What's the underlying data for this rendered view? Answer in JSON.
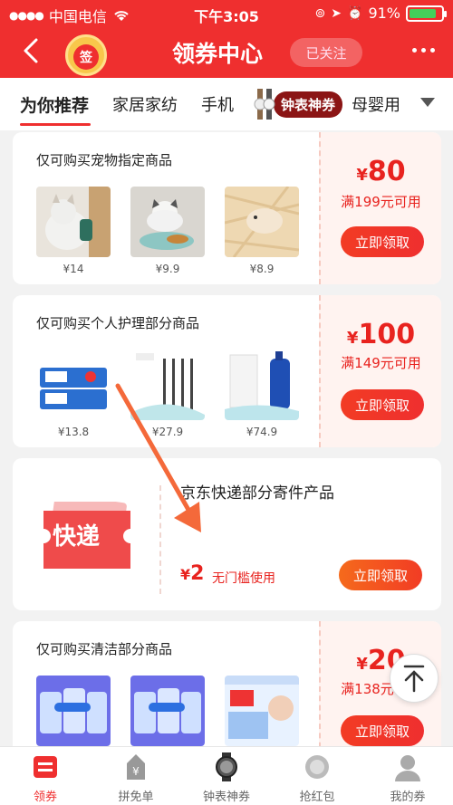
{
  "status": {
    "carrier": "中国电信",
    "time": "下午3:05",
    "battery": "91%"
  },
  "header": {
    "title": "领券中心",
    "followed_label": "已关注",
    "sign_label": "签"
  },
  "tabs": [
    {
      "label": "为你推荐"
    },
    {
      "label": "家居家纺"
    },
    {
      "label": "手机"
    },
    {
      "label": "钟表神券"
    },
    {
      "label": "母婴用"
    }
  ],
  "coupons": [
    {
      "title": "仅可购买宠物指定商品",
      "products": [
        {
          "price": "¥14"
        },
        {
          "price": "¥9.9"
        },
        {
          "price": "¥8.9"
        }
      ],
      "symbol": "¥",
      "amount": "80",
      "condition": "满199元可用",
      "button": "立即领取"
    },
    {
      "title": "仅可购买个人护理部分商品",
      "products": [
        {
          "price": "¥13.8"
        },
        {
          "price": "¥27.9"
        },
        {
          "price": "¥74.9"
        }
      ],
      "symbol": "¥",
      "amount": "100",
      "condition": "满149元可用",
      "button": "立即领取"
    },
    {
      "title": "仅可购买清洁部分商品",
      "symbol": "¥",
      "amount": "20",
      "condition": "满138元可用",
      "button": "立即领取"
    }
  ],
  "express": {
    "ticket_label": "快递",
    "title": "京东快递部分寄件产品",
    "symbol": "¥",
    "amount": "2",
    "condition": "无门槛使用",
    "button": "立即领取"
  },
  "bottom_nav": [
    {
      "label": "领券"
    },
    {
      "label": "拼免单"
    },
    {
      "label": "钟表神券"
    },
    {
      "label": "抢红包"
    },
    {
      "label": "我的券"
    }
  ],
  "colors": {
    "brand": "#ef2f2f",
    "coupon_red": "#e8231f",
    "express_orange": "#f56a1c"
  }
}
